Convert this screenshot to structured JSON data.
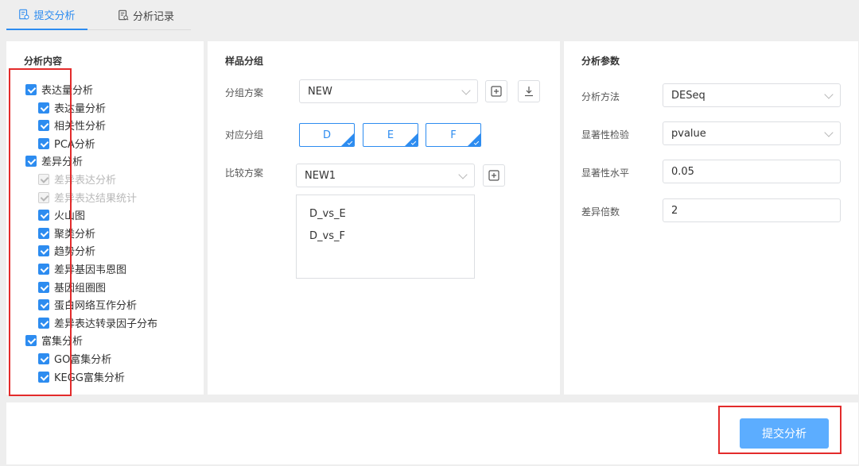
{
  "tabs": [
    {
      "label": "提交分析",
      "icon": "submit-doc-icon",
      "active": true
    },
    {
      "label": "分析记录",
      "icon": "record-doc-icon",
      "active": false
    }
  ],
  "left": {
    "title": "分析内容",
    "items": [
      {
        "label": "表达量分析",
        "checked": true,
        "disabled": false,
        "level": 0
      },
      {
        "label": "表达量分析",
        "checked": true,
        "disabled": false,
        "level": 1
      },
      {
        "label": "相关性分析",
        "checked": true,
        "disabled": false,
        "level": 1
      },
      {
        "label": "PCA分析",
        "checked": true,
        "disabled": false,
        "level": 1
      },
      {
        "label": "差异分析",
        "checked": true,
        "disabled": false,
        "level": 0
      },
      {
        "label": "差异表达分析",
        "checked": true,
        "disabled": true,
        "level": 1
      },
      {
        "label": "差异表达结果统计",
        "checked": true,
        "disabled": true,
        "level": 1
      },
      {
        "label": "火山图",
        "checked": true,
        "disabled": false,
        "level": 1
      },
      {
        "label": "聚类分析",
        "checked": true,
        "disabled": false,
        "level": 1
      },
      {
        "label": "趋势分析",
        "checked": true,
        "disabled": false,
        "level": 1
      },
      {
        "label": "差异基因韦恩图",
        "checked": true,
        "disabled": false,
        "level": 1
      },
      {
        "label": "基因组圈图",
        "checked": true,
        "disabled": false,
        "level": 1
      },
      {
        "label": "蛋白网络互作分析",
        "checked": true,
        "disabled": false,
        "level": 1
      },
      {
        "label": "差异表达转录因子分布",
        "checked": true,
        "disabled": false,
        "level": 1
      },
      {
        "label": "富集分析",
        "checked": true,
        "disabled": false,
        "level": 0
      },
      {
        "label": "GO富集分析",
        "checked": true,
        "disabled": false,
        "level": 1
      },
      {
        "label": "KEGG富集分析",
        "checked": true,
        "disabled": false,
        "level": 1
      }
    ]
  },
  "middle": {
    "title": "样品分组",
    "group_scheme_label": "分组方案",
    "group_scheme_value": "NEW",
    "group_label": "对应分组",
    "groups": [
      "D",
      "E",
      "F"
    ],
    "compare_label": "比较方案",
    "compare_value": "NEW1",
    "comparisons": [
      "D_vs_E",
      "D_vs_F"
    ]
  },
  "right": {
    "title": "分析参数",
    "method_label": "分析方法",
    "method_value": "DESeq",
    "test_label": "显著性检验",
    "test_value": "pvalue",
    "level_label": "显著性水平",
    "level_value": "0.05",
    "fold_label": "差异倍数",
    "fold_value": "2"
  },
  "bottom": {
    "submit_label": "提交分析"
  },
  "colors": {
    "primary": "#2d8cf0",
    "submit": "#5cadff",
    "highlight": "#e32b2b"
  }
}
